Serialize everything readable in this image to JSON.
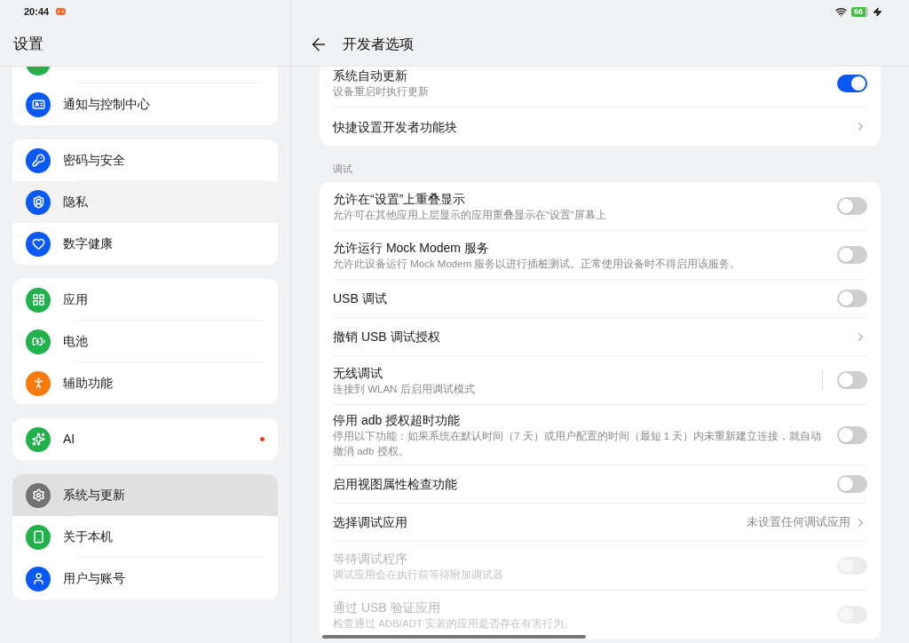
{
  "status_bar": {
    "time": "20:44",
    "battery": "66"
  },
  "sidebar": {
    "title": "设置",
    "groups": [
      {
        "items": [
          {
            "color": "#21b14c",
            "selected": false,
            "highlighted": false,
            "dot": false
          },
          {
            "label": "通知与控制中心",
            "color": "#0a59f7",
            "selected": false,
            "highlighted": false,
            "dot": false
          }
        ]
      },
      {
        "items": [
          {
            "label": "密码与安全",
            "color": "#0a59f7",
            "selected": false,
            "highlighted": false,
            "dot": false
          },
          {
            "label": "隐私",
            "color": "#0a59f7",
            "selected": false,
            "highlighted": true,
            "dot": false
          },
          {
            "label": "数字健康",
            "color": "#0a59f7",
            "selected": false,
            "highlighted": false,
            "dot": false
          }
        ]
      },
      {
        "items": [
          {
            "label": "应用",
            "color": "#21b14c",
            "selected": false,
            "highlighted": false,
            "dot": false
          },
          {
            "label": "电池",
            "color": "#21b14c",
            "selected": false,
            "highlighted": false,
            "dot": false
          },
          {
            "label": "辅助功能",
            "color": "#f97a0f",
            "selected": false,
            "highlighted": false,
            "dot": false
          }
        ]
      },
      {
        "items": [
          {
            "label": "AI",
            "color": "#21b14c",
            "selected": false,
            "highlighted": false,
            "dot": true
          }
        ]
      },
      {
        "items": [
          {
            "label": "系统与更新",
            "color": "#737373",
            "selected": true,
            "highlighted": false,
            "dot": false
          },
          {
            "label": "关于本机",
            "color": "#21b14c",
            "selected": false,
            "highlighted": false,
            "dot": false
          },
          {
            "label": "用户与账号",
            "color": "#0a59f7",
            "selected": false,
            "highlighted": false,
            "dot": false
          }
        ]
      }
    ]
  },
  "detail": {
    "title": "开发者选项",
    "sections": [
      {
        "rows": [
          {
            "kind": "toggle",
            "title": "系统自动更新",
            "subtitle": "设备重启时执行更新",
            "on": true,
            "disabled": false,
            "divider": false
          },
          {
            "kind": "link",
            "title": "快捷设置开发者功能块"
          }
        ]
      },
      {
        "header": "调试",
        "rows": [
          {
            "kind": "toggle",
            "title": "允许在“设置”上重叠显示",
            "subtitle": "允许可在其他应用上层显示的应用重叠显示在“设置”屏幕上",
            "on": false,
            "disabled": false,
            "divider": false
          },
          {
            "kind": "toggle",
            "title": "允许运行 Mock Modem 服务",
            "subtitle": "允许此设备运行 Mock Modem 服务以进行插桩测试。正常使用设备时不得启用该服务。",
            "on": false,
            "disabled": false,
            "divider": false
          },
          {
            "kind": "toggle",
            "title": "USB 调试",
            "on": false,
            "disabled": false,
            "divider": false
          },
          {
            "kind": "link",
            "title": "撤销 USB 调试授权"
          },
          {
            "kind": "toggle",
            "title": "无线调试",
            "subtitle": "连接到 WLAN 后启用调试模式",
            "on": false,
            "disabled": false,
            "divider": true
          },
          {
            "kind": "toggle",
            "title": "停用 adb 授权超时功能",
            "subtitle": "停用以下功能：如果系统在默认时间（7 天）或用户配置的时间（最短 1 天）内未重新建立连接，就自动撤消 adb 授权。",
            "on": false,
            "disabled": false,
            "divider": false
          },
          {
            "kind": "toggle",
            "title": "启用视图属性检查功能",
            "on": false,
            "disabled": false,
            "divider": false
          },
          {
            "kind": "link",
            "title": "选择调试应用",
            "value": "未设置任何调试应用"
          },
          {
            "kind": "toggle",
            "title": "等待调试程序",
            "subtitle": "调试应用会在执行前等待附加调试器",
            "on": false,
            "disabled": true,
            "divider": false
          },
          {
            "kind": "toggle",
            "title": "通过 USB 验证应用",
            "subtitle": "检查通过 ADB/ADT 安装的应用是否存在有害行为。",
            "on": false,
            "disabled": true,
            "divider": false
          }
        ]
      }
    ]
  }
}
